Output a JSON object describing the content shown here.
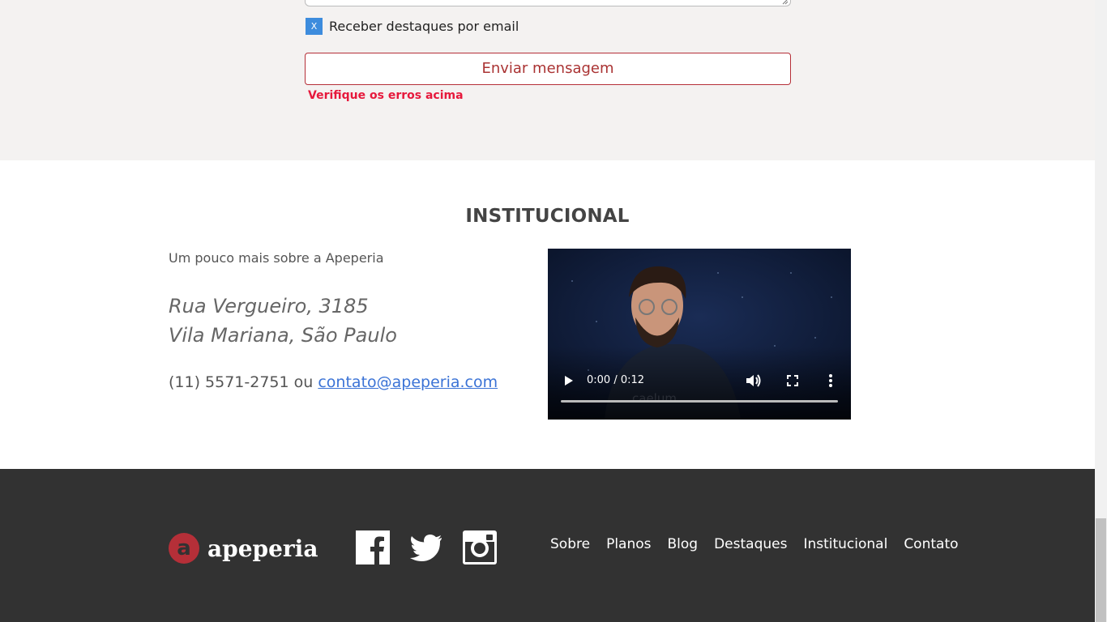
{
  "form": {
    "newsletter_label": "Receber destaques por email",
    "newsletter_checked_mark": "X",
    "send_label": "Enviar mensagem",
    "error_text": "Verifique os erros acima"
  },
  "institucional": {
    "title": "INSTITUCIONAL",
    "subtitle": "Um pouco mais sobre a Apeperia",
    "address_line1": "Rua Vergueiro, 3185",
    "address_line2": "Vila Mariana, São Paulo",
    "phone": "(11) 5571-2751",
    "conj": " ou ",
    "email": "contato@apeperia.com"
  },
  "video": {
    "time": "0:00 / 0:12",
    "watermark": "caelum",
    "progress": 0
  },
  "footer": {
    "brand": "apeperia",
    "social": [
      "facebook-icon",
      "twitter-icon",
      "instagram-icon"
    ],
    "nav": [
      "Sobre",
      "Planos",
      "Blog",
      "Destaques",
      "Institucional",
      "Contato"
    ]
  },
  "colors": {
    "accent": "#b52f38",
    "error": "#e6193c",
    "link": "#3b73d6",
    "footer_bg": "#323232"
  }
}
